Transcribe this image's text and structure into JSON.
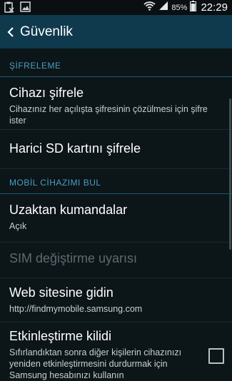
{
  "status": {
    "battery": "85%",
    "time": "22:29"
  },
  "header": {
    "title": "Güvenlik"
  },
  "sections": [
    {
      "header": "ŞİFRELEME"
    },
    {
      "header": "MOBİL CİHAZIMI BUL"
    }
  ],
  "items": {
    "encrypt_device": {
      "title": "Cihazı şifrele",
      "subtitle": "Cihazınız her açılışta şifresinin çözülmesi için şifre ister"
    },
    "encrypt_sd": {
      "title": "Harici SD kartını şifrele"
    },
    "remote_controls": {
      "title": "Uzaktan kumandalar",
      "subtitle": "Açık"
    },
    "sim_change_alert": {
      "title": "SIM değiştirme uyarısı"
    },
    "go_to_website": {
      "title": "Web sitesine gidin",
      "subtitle": "http://findmymobile.samsung.com"
    },
    "reactivation_lock": {
      "title": "Etkinleştirme kilidi",
      "subtitle": "Sıfırlandıktan sonra diğer kişilerin cihazınızı yeniden etkinleştirmesini durdurmak için Samsung hesabınızı kullanın"
    }
  },
  "colors": {
    "background": "#0c1518",
    "actionbar": "#0f3a4d",
    "section_header": "#4a9ec2"
  }
}
